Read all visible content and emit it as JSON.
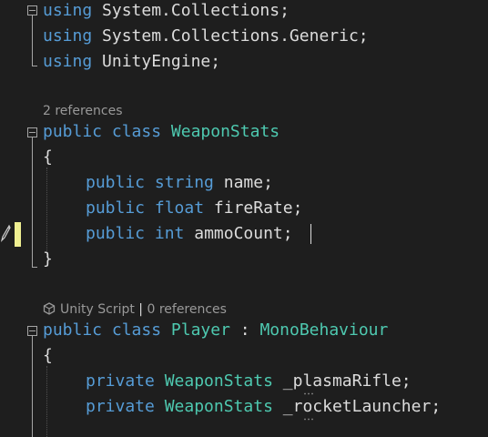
{
  "code": {
    "line1": {
      "kw": "using",
      "ns": "System.Collections;"
    },
    "line2": {
      "kw": "using",
      "ns": "System.Collections.Generic;"
    },
    "line3": {
      "kw": "using",
      "ns": "UnityEngine;"
    },
    "lens1": {
      "text": "2 references"
    },
    "class1": {
      "mod": "public",
      "kw": "class",
      "name": "WeaponStats"
    },
    "open_brace": "{",
    "close_brace": "}",
    "field1": {
      "mod": "public",
      "type": "string",
      "name": "name;"
    },
    "field2": {
      "mod": "public",
      "type": "float",
      "name": "fireRate;"
    },
    "field3": {
      "mod": "public",
      "type": "int",
      "name": "ammoCount;"
    },
    "lens2": {
      "script": "Unity Script",
      "sep": "|",
      "refs": "0 references"
    },
    "class2": {
      "mod": "public",
      "kw": "class",
      "name": "Player",
      "colon": ":",
      "base": "MonoBehaviour"
    },
    "field4": {
      "mod": "private",
      "type": "WeaponStats",
      "name": "_plasmaRifle;"
    },
    "field5": {
      "mod": "private",
      "type": "WeaponStats",
      "name": "_rocketLauncher;"
    }
  },
  "colors": {
    "background": "#1e1e1e",
    "keyword": "#569cd6",
    "type": "#4ec9b0",
    "identifier": "#dcdcdc",
    "codelens": "#999999",
    "change_marker": "#efef91"
  },
  "icons": [
    "fold-icon",
    "pencil-icon",
    "unity-icon"
  ]
}
